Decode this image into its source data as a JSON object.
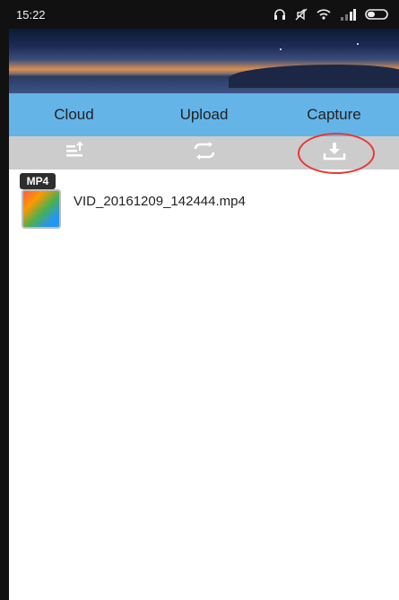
{
  "status_bar": {
    "time": "15:22",
    "icons": [
      "headphones-icon",
      "mute-icon",
      "wifi-icon",
      "signal-icon",
      "battery-icon"
    ]
  },
  "tabs": [
    {
      "label": "Cloud"
    },
    {
      "label": "Upload"
    },
    {
      "label": "Capture"
    }
  ],
  "toolbar": [
    {
      "icon": "sort-icon"
    },
    {
      "icon": "refresh-icon"
    },
    {
      "icon": "download-icon"
    }
  ],
  "files": [
    {
      "name": "VID_20161209_142444.mp4",
      "badge": "MP4"
    }
  ],
  "colors": {
    "tab_bar": "#64b4e8",
    "toolbar": "#cccccc",
    "highlight": "#e53935"
  }
}
